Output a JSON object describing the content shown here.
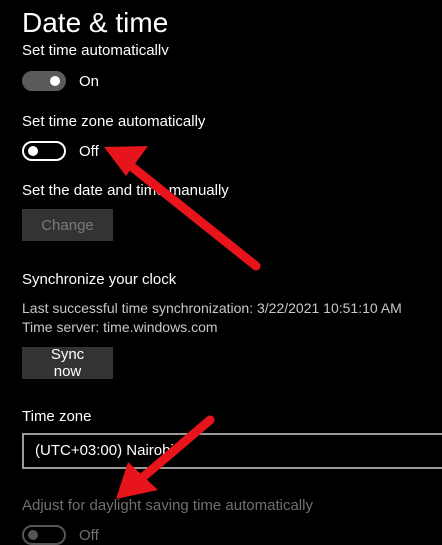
{
  "page": {
    "title": "Date & time"
  },
  "set_time_auto": {
    "label": "Set time automatically",
    "state": "On"
  },
  "set_timezone_auto": {
    "label": "Set time zone automatically",
    "state": "Off"
  },
  "manual": {
    "label": "Set the date and time manually",
    "button": "Change"
  },
  "sync": {
    "heading": "Synchronize your clock",
    "last_sync": "Last successful time synchronization: 3/22/2021 10:51:10 AM",
    "server": "Time server: time.windows.com",
    "button": "Sync now"
  },
  "timezone": {
    "label": "Time zone",
    "value": "(UTC+03:00) Nairobi"
  },
  "dst": {
    "label": "Adjust for daylight saving time automatically",
    "state": "Off"
  },
  "colors": {
    "annotation_arrow": "#e8141b",
    "background": "#000000"
  }
}
